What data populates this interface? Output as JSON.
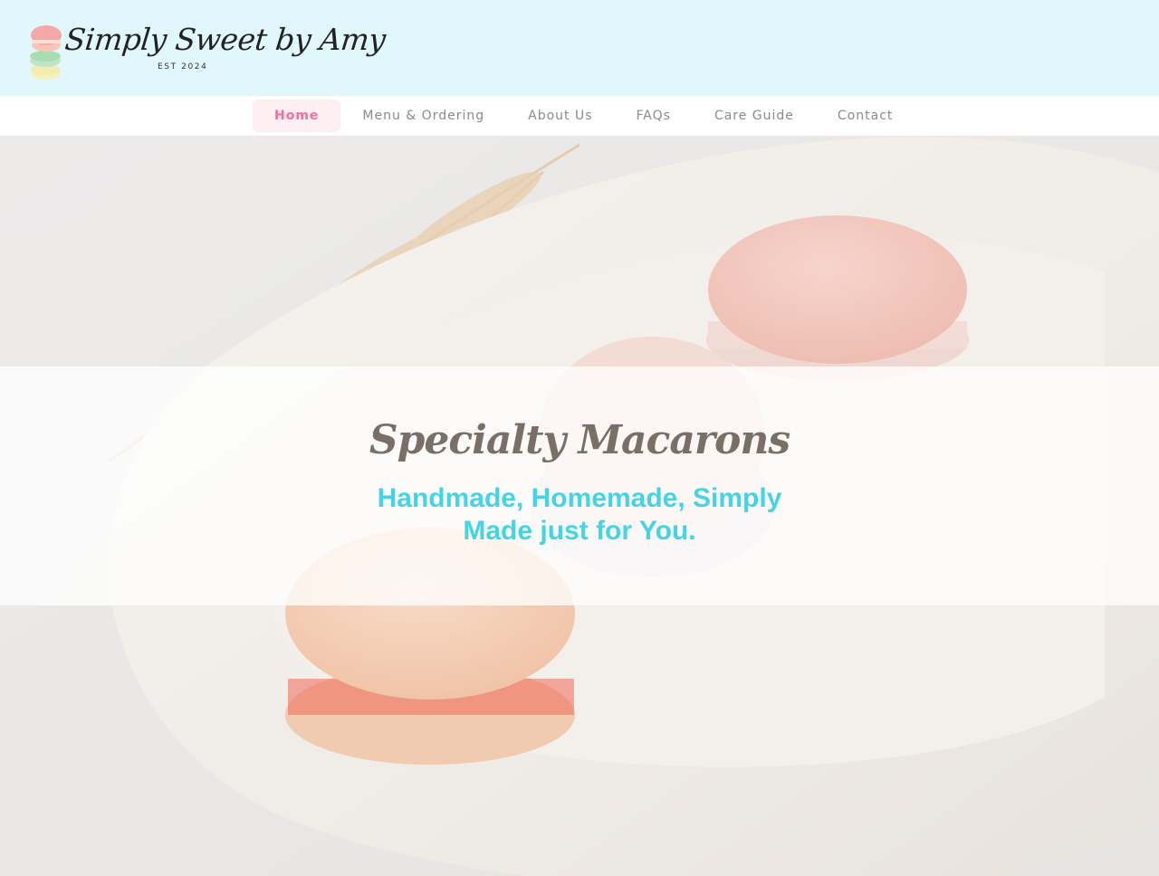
{
  "header": {
    "logo": {
      "wordmark": "Simply Sweet by Amy",
      "est": "EST 2024",
      "stack_colors": [
        "#f4a9a8",
        "#bfe6c4",
        "#f6f1b8"
      ]
    },
    "background": "#e0f7fb"
  },
  "nav": {
    "items": [
      {
        "label": "Home",
        "active": true
      },
      {
        "label": "Menu & Ordering",
        "active": false
      },
      {
        "label": "About Us",
        "active": false
      },
      {
        "label": "FAQs",
        "active": false
      },
      {
        "label": "Care Guide",
        "active": false
      },
      {
        "label": "Contact",
        "active": false
      }
    ],
    "active_color": "#f06f9c",
    "active_bg": "#fdeef1"
  },
  "hero": {
    "title": "Specialty Macarons",
    "subtitle": "Handmade, Homemade, Simply Made just for You.",
    "subtitle_color": "#45d3e6"
  }
}
